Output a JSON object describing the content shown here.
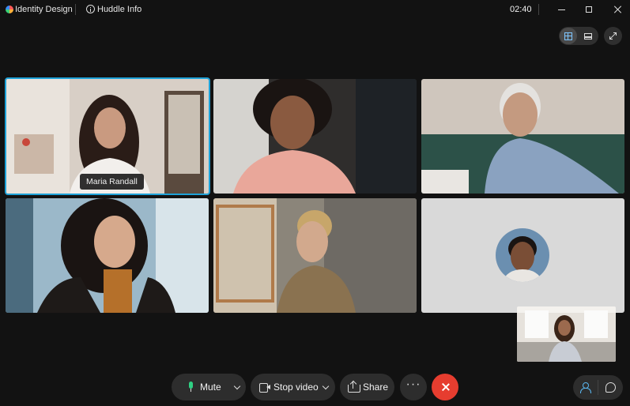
{
  "window": {
    "app_title": "Identity Design",
    "huddle_info_label": "Huddle Info",
    "elapsed_time": "02:40"
  },
  "view_controls": {
    "layout_options": [
      "grid-icon",
      "stage-icon"
    ],
    "selected_layout": "grid",
    "fullscreen_icon": "expand-icon"
  },
  "participants": [
    {
      "name": "Maria Randall",
      "active_speaker": true
    },
    {
      "name": "",
      "active_speaker": false
    },
    {
      "name": "",
      "active_speaker": false
    },
    {
      "name": "",
      "active_speaker": false
    },
    {
      "name": "",
      "active_speaker": false
    },
    {
      "name": "",
      "video_off": true
    }
  ],
  "toolbar": {
    "mute_label": "Mute",
    "stop_video_label": "Stop video",
    "share_label": "Share",
    "more_label": "···"
  },
  "colors": {
    "accent": "#1ea2d8",
    "end_call": "#e63d2f",
    "mic_active": "#2fd083"
  }
}
